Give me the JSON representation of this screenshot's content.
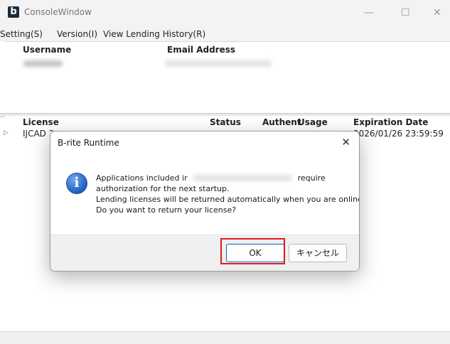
{
  "window": {
    "app_icon_letter": "b",
    "title": "ConsoleWindow",
    "minimize": "—",
    "maximize": "☐",
    "close": "✕"
  },
  "menu": [
    "Setting(S)",
    "Version(I)",
    "View Lending History(R)"
  ],
  "users_table": {
    "headers": [
      "Username",
      "Email Address"
    ]
  },
  "license_table": {
    "headers": [
      "License",
      "Status",
      "Authent",
      "Usage",
      "Expiration Date"
    ],
    "row": {
      "expander": "▷",
      "license": "IJCAD 2",
      "expiration": "2026/01/26 23:59:59"
    }
  },
  "dialog": {
    "title": "B-rite Runtime",
    "close": "✕",
    "icon": "info-icon",
    "message_line1_prefix": "Applications included ir",
    "message_line1_suffix": "require",
    "message_line2": "authorization for the next startup.",
    "message_line3": "Lending licenses will be returned automatically when you are online.",
    "message_line4": "Do you want to return your license?",
    "ok_label": "OK",
    "cancel_label": "キャンセル"
  },
  "colors": {
    "highlight": "#e01b1b",
    "accent": "#0067c0"
  }
}
